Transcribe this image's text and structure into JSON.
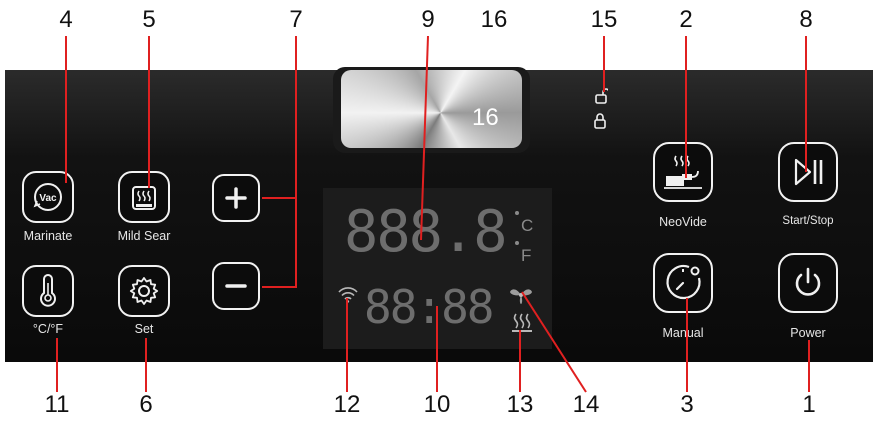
{
  "callouts": {
    "n1": "1",
    "n2": "2",
    "n3": "3",
    "n4": "4",
    "n5": "5",
    "n6": "6",
    "n7": "7",
    "n8": "8",
    "n9": "9",
    "n10": "10",
    "n11": "11",
    "n12": "12",
    "n13": "13",
    "n14": "14",
    "n15": "15",
    "n16": "16"
  },
  "buttons": {
    "marinate": {
      "label": "Marinate",
      "icon": "vacuum-icon",
      "icon_text": "Vac"
    },
    "mild_sear": {
      "label": "Mild Sear",
      "icon": "sear-pan-icon"
    },
    "temp_unit": {
      "label": "°C/°F",
      "icon": "thermometer-icon"
    },
    "set": {
      "label": "Set",
      "icon": "gear-icon"
    },
    "plus": {
      "icon": "plus-icon"
    },
    "minus": {
      "icon": "minus-icon"
    },
    "neovide": {
      "label": "NeoVide",
      "icon": "sous-vide-icon"
    },
    "manual": {
      "label": "Manual",
      "icon": "timer-icon"
    },
    "start_stop": {
      "label": "Start/Stop",
      "icon": "play-pause-icon"
    },
    "power": {
      "label": "Power",
      "icon": "power-icon"
    }
  },
  "display": {
    "temperature_digits": "888.8",
    "unit_c": "C",
    "unit_f": "F",
    "time_digits": "88:88",
    "icons": [
      "wifi-icon",
      "fan-icon",
      "heating-icon"
    ]
  },
  "indicators": {
    "icons": [
      "unlock-icon",
      "lock-icon"
    ]
  },
  "window": {
    "number": "16"
  },
  "colors": {
    "panel": "#0a0a0a",
    "callout_line": "#e02020",
    "button_border": "#f2f2f2",
    "display_bg": "#1c1c1c"
  }
}
